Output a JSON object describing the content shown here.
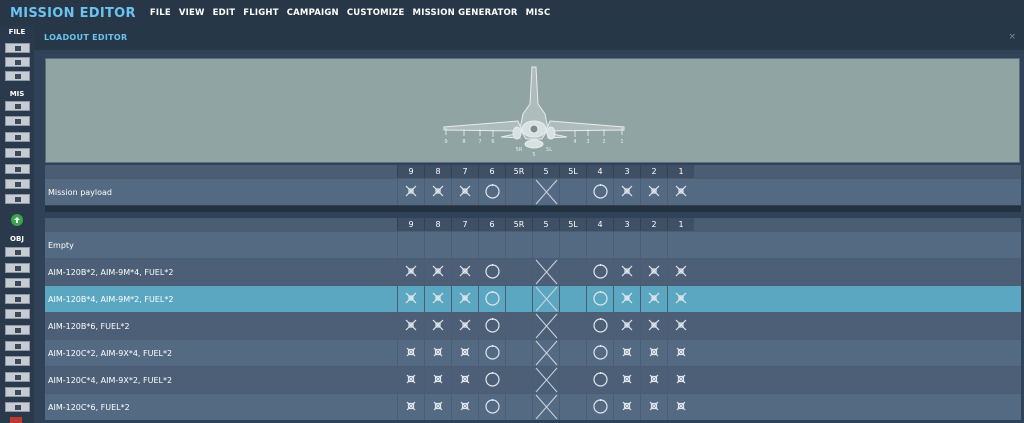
{
  "app": {
    "title": "MISSION EDITOR",
    "menu": [
      "FILE",
      "VIEW",
      "EDIT",
      "FLIGHT",
      "CAMPAIGN",
      "CUSTOMIZE",
      "MISSION GENERATOR",
      "MISC"
    ]
  },
  "sidebar": {
    "sections": [
      "FILE",
      "MIS",
      "OBJ"
    ],
    "file_icons": [
      "new-icon",
      "open-icon",
      "save-icon"
    ],
    "mis_icons": [
      "briefing-icon",
      "weather-icon",
      "goals-icon",
      "triggers-icon",
      "resources-icon",
      "check-icon",
      "mission-chain-icon"
    ],
    "obj_icons": [
      "aircraft-icon",
      "helicopter-icon",
      "ship-icon",
      "vehicle-icon",
      "static-icon",
      "structure-icon",
      "waypoint-icon",
      "zone-icon",
      "target-icon",
      "formation-icon",
      "shapes-icon"
    ]
  },
  "panel": {
    "title": "LOADOUT EDITOR",
    "close": "×"
  },
  "preview": {
    "pylon_labels": [
      "9",
      "8",
      "7",
      "6",
      "5R",
      "5",
      "5L",
      "4",
      "3",
      "2",
      "1"
    ]
  },
  "stations": [
    "9",
    "8",
    "7",
    "6",
    "5R",
    "5",
    "5L",
    "4",
    "3",
    "2",
    "1"
  ],
  "mission_payload": {
    "label": "Mission payload",
    "pattern": [
      "x",
      "x",
      "x",
      "o",
      "",
      "big",
      "",
      "o",
      "x",
      "x",
      "x"
    ]
  },
  "loadouts": [
    {
      "label": "Empty",
      "pattern": [
        "",
        "",
        "",
        "",
        "",
        "",
        "",
        "",
        "",
        "",
        ""
      ],
      "selected": false
    },
    {
      "label": "AIM-120B*2, AIM-9M*4, FUEL*2",
      "pattern": [
        "x",
        "x",
        "x",
        "o",
        "",
        "big",
        "",
        "o",
        "x",
        "x",
        "x"
      ],
      "selected": false
    },
    {
      "label": "AIM-120B*4, AIM-9M*2, FUEL*2",
      "pattern": [
        "x",
        "x",
        "x",
        "o",
        "",
        "big",
        "",
        "o",
        "x",
        "x",
        "x"
      ],
      "selected": true
    },
    {
      "label": "AIM-120B*6, FUEL*2",
      "pattern": [
        "x",
        "x",
        "x",
        "o",
        "",
        "big",
        "",
        "o",
        "x",
        "x",
        "x"
      ],
      "selected": false
    },
    {
      "label": "AIM-120C*2, AIM-9X*4, FUEL*2",
      "pattern": [
        "s",
        "s",
        "s",
        "o",
        "",
        "big",
        "",
        "o",
        "s",
        "s",
        "s"
      ],
      "selected": false
    },
    {
      "label": "AIM-120C*4, AIM-9X*2, FUEL*2",
      "pattern": [
        "s",
        "s",
        "s",
        "o",
        "",
        "big",
        "",
        "o",
        "s",
        "s",
        "s"
      ],
      "selected": false
    },
    {
      "label": "AIM-120C*6, FUEL*2",
      "pattern": [
        "s",
        "s",
        "s",
        "o",
        "",
        "big",
        "",
        "o",
        "s",
        "s",
        "s"
      ],
      "selected": false
    }
  ],
  "colors": {
    "accent": "#6cc3ef",
    "row_a": "#546982",
    "row_b": "#4c5f77",
    "selected": "#5ba7c1",
    "header_bg": "#4a5d73"
  }
}
